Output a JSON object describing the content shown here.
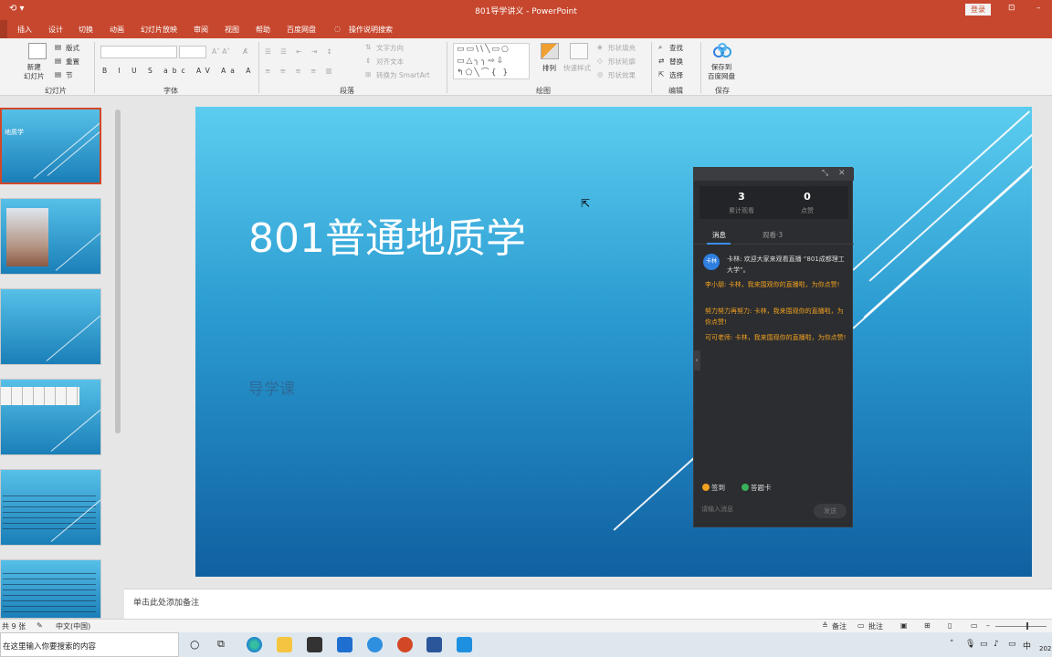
{
  "window": {
    "title": "801导学讲义  -  PowerPoint",
    "login_label": "登录"
  },
  "menu": {
    "tabs": [
      "插入",
      "设计",
      "切换",
      "动画",
      "幻灯片放映",
      "审阅",
      "视图",
      "帮助",
      "百度网盘"
    ],
    "tell_me": "操作说明搜索"
  },
  "ribbon": {
    "groups": {
      "slides": "幻灯片",
      "font": "字体",
      "paragraph": "段落",
      "drawing": "绘图",
      "editing": "编辑",
      "save": "保存"
    },
    "slides": {
      "new_slide": "新建\n幻灯片",
      "layout": "版式",
      "reset": "重置",
      "section": "节"
    },
    "paragraph": {
      "text_direction": "文字方向",
      "align_text": "对齐文本",
      "smartart": "转换为 SmartArt"
    },
    "drawing": {
      "arrange": "排列",
      "quick_styles": "快速样式",
      "shape_fill": "形状填充",
      "shape_outline": "形状轮廓",
      "shape_effects": "形状效果"
    },
    "editing": {
      "find": "查找",
      "replace": "替换",
      "select": "选择"
    },
    "save": {
      "save_to_cloud": "保存到\n百度网盘"
    }
  },
  "thumbnails": [
    {
      "text": "地质学",
      "selected": true
    },
    {
      "text": "",
      "selected": false
    },
    {
      "text": "",
      "selected": false
    },
    {
      "text": "",
      "selected": false
    },
    {
      "text": "",
      "selected": false
    },
    {
      "text": "",
      "selected": false
    }
  ],
  "slide": {
    "title": "801普通地质学",
    "subtitle": "导学课"
  },
  "notes": {
    "placeholder": "单击此处添加备注"
  },
  "statusbar": {
    "slide_count": "共 9 张",
    "language": "中文(中国)",
    "notes_label": "备注",
    "comments_label": "批注"
  },
  "taskbar": {
    "search_placeholder": "在这里输入你要搜索的内容",
    "ime": "中",
    "date_partial": "202"
  },
  "live": {
    "stats": [
      {
        "value": "3",
        "label": "累计观看"
      },
      {
        "value": "0",
        "label": "点赞"
      }
    ],
    "tabs": [
      "消息",
      "观看·3"
    ],
    "system_message": "卡林: 欢迎大家来观看直播 “801成都理工大学”。",
    "avatar_text": "卡林",
    "messages": [
      "李小朋: 卡林，我来围观你的直播啦，为你点赞!",
      "努力努力再努力: 卡林，我来围观你的直播啦，为你点赞!",
      "可可老师: 卡林，我来围观你的直播啦，为你点赞!"
    ],
    "actions": [
      "签到",
      "答题卡"
    ],
    "input_placeholder": "请输入消息",
    "send_label": "发送"
  },
  "colors": {
    "titlebar": "#c7472e",
    "slide_top": "#5ccdf0",
    "slide_bottom": "#1060a0",
    "live_panel": "#2b2d30",
    "chat_highlight": "#f0a020"
  }
}
